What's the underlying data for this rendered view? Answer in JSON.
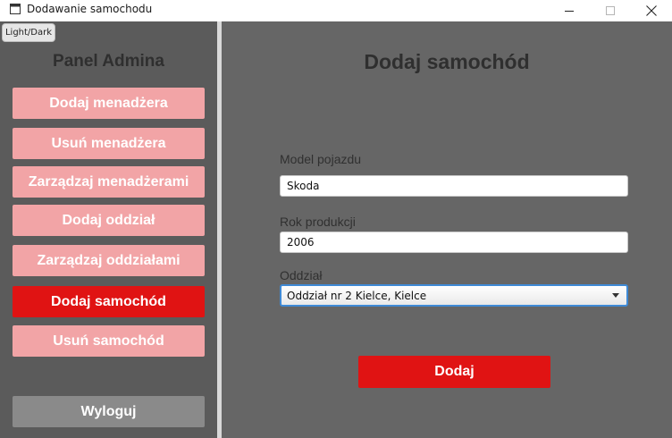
{
  "window": {
    "title": "Dodawanie samochodu"
  },
  "toolbar": {
    "theme_toggle": "Light/Dark"
  },
  "sidebar": {
    "title": "Panel Admina",
    "items": [
      {
        "label": "Dodaj menadżera",
        "active": false
      },
      {
        "label": "Usuń menadżera",
        "active": false
      },
      {
        "label": "Zarządzaj menadżerami",
        "active": false
      },
      {
        "label": "Dodaj oddział",
        "active": false
      },
      {
        "label": "Zarządzaj oddziałami",
        "active": false
      },
      {
        "label": "Dodaj samochód",
        "active": true
      },
      {
        "label": "Usuń samochód",
        "active": false
      }
    ],
    "logout_label": "Wyloguj"
  },
  "main": {
    "title": "Dodaj samochód",
    "model": {
      "label": "Model pojazdu",
      "value": "Skoda"
    },
    "year": {
      "label": "Rok produkcji",
      "value": "2006"
    },
    "branch": {
      "label": "Oddział",
      "selected": "Oddział nr 2 Kielce, Kielce"
    },
    "submit_label": "Dodaj"
  },
  "colors": {
    "accent": "#e01313",
    "inactive_button": "#f2a4a6",
    "logout_button": "#8a8a8a",
    "background": "#666666",
    "sidebar_background": "#5b5b5b"
  }
}
